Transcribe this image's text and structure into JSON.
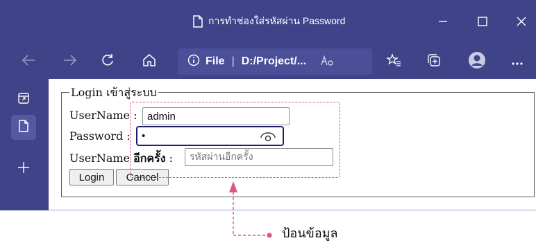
{
  "window": {
    "title": "การทำช่องใส่รหัสผ่าน Password"
  },
  "address_bar": {
    "scheme_label": "File",
    "separator": "|",
    "url": "D:/Project/..."
  },
  "form": {
    "legend": "Login เข้าสู่ระบบ",
    "username_label": "UserName :",
    "username_value": "admin",
    "password_label": "Password :",
    "password_value": "•",
    "confirm_label_prefix": "UserName",
    "confirm_label_bold": "อีกครั้ง",
    "confirm_label_suffix": " :",
    "confirm_placeholder": "รหัสผ่านอีกครั้ง",
    "login_button": "Login",
    "cancel_button": "Cancel"
  },
  "annotation": {
    "text": "ป้อนข้อมูล",
    "accent_color": "#e0508a"
  },
  "colors": {
    "chrome": "#3f4489",
    "address_bg": "#4a4f98"
  },
  "icons": {
    "title": "document-icon",
    "window": [
      "minimize-icon",
      "maximize-icon",
      "close-icon"
    ],
    "nav": [
      "back-icon",
      "forward-icon",
      "refresh-icon",
      "home-icon",
      "info-icon",
      "read-aloud-icon",
      "favorites-icon",
      "collections-icon",
      "profile-icon",
      "more-icon"
    ],
    "sidebar": [
      "workspaces-icon",
      "tab-icon",
      "add-icon"
    ],
    "password": "eye-icon"
  }
}
